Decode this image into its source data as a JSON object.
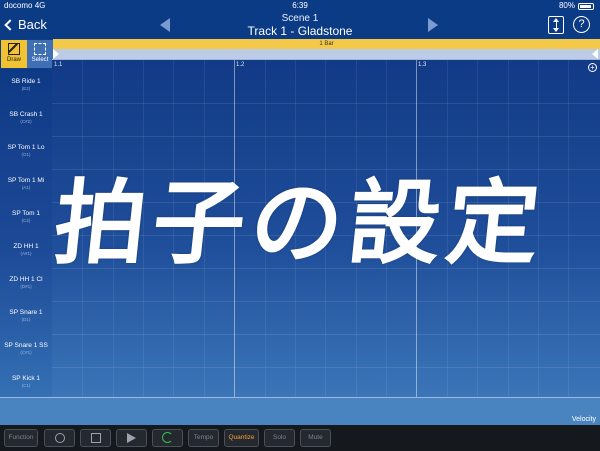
{
  "status_bar": {
    "carrier": "docomo",
    "network": "4G",
    "time": "6:39",
    "battery": "80%"
  },
  "nav": {
    "back_label": "Back",
    "scene": "Scene  1",
    "track": "Track 1 - Gladstone",
    "help_label": "?"
  },
  "tools": {
    "draw_label": "Draw",
    "select_label": "Select"
  },
  "timeline": {
    "bar_label": "1 Bar",
    "beats": [
      "1.1",
      "1.2",
      "1.3"
    ],
    "add_label": "+"
  },
  "instruments": [
    {
      "name": "SB Ride 1",
      "note": "(E2)"
    },
    {
      "name": "SB Crash 1",
      "note": "(C#2)"
    },
    {
      "name": "SP Tom 1 Lo",
      "note": "(G1)"
    },
    {
      "name": "SP Tom 1 Mi",
      "note": "(A1)"
    },
    {
      "name": "SP Tom 1",
      "note": "(C2)"
    },
    {
      "name": "ZD HH 1",
      "note": "(A#1)"
    },
    {
      "name": "ZD HH 1 Cl",
      "note": "(D#1)"
    },
    {
      "name": "SP Snare 1",
      "note": "(D1)"
    },
    {
      "name": "SP Snare 1 SS",
      "note": "(C#1)"
    },
    {
      "name": "SP Kick 1",
      "note": "(C1)"
    }
  ],
  "velocity_label": "Velocity",
  "toolbar": {
    "function_label": "Function",
    "tempo_label": "Tempo",
    "quantize_label": "Quantize",
    "solo_label": "Solo",
    "mute_label": "Mute"
  },
  "overlay_text": "拍子の設定",
  "colors": {
    "background": "#0f3f86",
    "draw_tool": "#f1c232",
    "bar_strip": "#f4c94a",
    "quantize_active": "#f2a33b",
    "loop_icon": "#35c04b"
  }
}
